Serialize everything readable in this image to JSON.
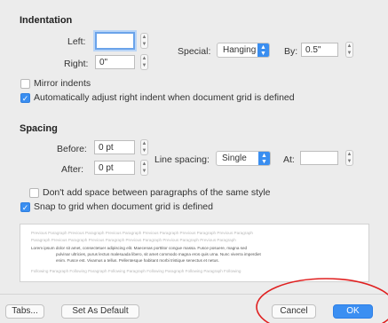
{
  "indentation": {
    "title": "Indentation",
    "left_label": "Left:",
    "left_value": "",
    "right_label": "Right:",
    "right_value": "0\"",
    "special_label": "Special:",
    "special_value": "Hanging",
    "by_label": "By:",
    "by_value": "0.5\""
  },
  "options": {
    "mirror_label": "Mirror indents",
    "auto_adjust_label": "Automatically adjust right indent when document grid is defined"
  },
  "spacing": {
    "title": "Spacing",
    "before_label": "Before:",
    "before_value": "0 pt",
    "after_label": "After:",
    "after_value": "0 pt",
    "line_spacing_label": "Line spacing:",
    "line_spacing_value": "Single",
    "at_label": "At:",
    "at_value": "",
    "dont_add_label": "Don't add space between paragraphs of the same style",
    "snap_label": "Snap to grid when document grid is defined"
  },
  "preview": {
    "previous_lines": [
      "Previous Paragraph Previous Paragraph Previous Paragraph Previous Paragraph Previous Paragraph Previous Paragraph",
      "Paragraph Previous Paragraph Previous Paragraph Previous Paragraph Previous Paragraph Previous Paragraph"
    ],
    "sample_lines": [
      "Lorem ipsum dolor sit amet, consectetuer adipiscing elit. Maecenas porttitor congue massa. Fusce posuere, magna sed",
      "pulvinar ultricies, purus lectus malesuada libero, sit amet commodo magna eros quis urna. Nunc viverra imperdiet",
      "enim. Fusce est. Vivamus a tellus. Pellentesque habitant morbi tristique senectus et netus."
    ],
    "following_lines": [
      "Following Paragraph Following Paragraph Following Paragraph Following Paragraph Following Paragraph Following"
    ]
  },
  "buttons": {
    "tabs": "Tabs...",
    "set_default": "Set As Default",
    "cancel": "Cancel",
    "ok": "OK"
  },
  "colors": {
    "accent": "#3b8ff2",
    "annotation": "#e02020"
  }
}
